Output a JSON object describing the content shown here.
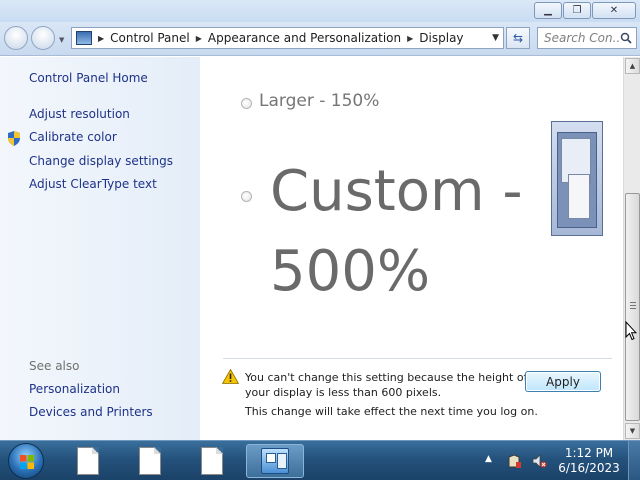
{
  "window": {
    "controls": {
      "minimize": "minimize",
      "maximize": "maximize",
      "close": "close"
    }
  },
  "navigation": {
    "breadcrumbs": [
      "Control Panel",
      "Appearance and Personalization",
      "Display"
    ],
    "search_placeholder": "Search Con..."
  },
  "sidebar": {
    "home": "Control Panel Home",
    "items": [
      "Adjust resolution",
      "Calibrate color",
      "Change display settings",
      "Adjust ClearType text"
    ],
    "see_also_heading": "See also",
    "see_also": [
      "Personalization",
      "Devices and Printers"
    ]
  },
  "main": {
    "options": [
      {
        "label": "Larger - 150%",
        "selected": false
      },
      {
        "label": "Custom - 500%",
        "selected": false
      }
    ],
    "warning": "You can't change this setting because the height of your display is less than 600 pixels.",
    "note": "This change will take effect the next time you log on.",
    "apply_label": "Apply"
  },
  "taskbar": {
    "apps": [
      "document",
      "document",
      "document",
      "control-panel"
    ],
    "active_app": "control-panel",
    "time": "1:12 PM",
    "date": "6/16/2023"
  },
  "colors": {
    "link": "#1e3287",
    "taskbar": "#24527c",
    "apply_border": "#3c7fb1"
  }
}
